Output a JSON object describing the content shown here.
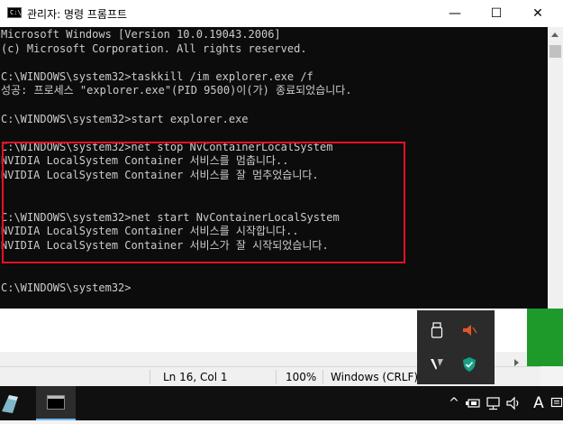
{
  "window": {
    "title": "관리자: 명령 프롬프트",
    "icon": "cmd-icon",
    "icon_glyph": "C:\\",
    "minimize_glyph": "—",
    "maximize_glyph": "☐",
    "close_glyph": "✕"
  },
  "console": {
    "lines": [
      "Microsoft Windows [Version 10.0.19043.2006]",
      "(c) Microsoft Corporation. All rights reserved.",
      "",
      "C:\\WINDOWS\\system32>taskkill /im explorer.exe /f",
      "성공: 프로세스 \"explorer.exe\"(PID 9500)이(가) 종료되었습니다.",
      "",
      "C:\\WINDOWS\\system32>start explorer.exe",
      "",
      "C:\\WINDOWS\\system32>net stop NvContainerLocalSystem",
      "NVIDIA LocalSystem Container 서비스를 멈춥니다..",
      "NVIDIA LocalSystem Container 서비스를 잘 멈추었습니다.",
      "",
      "",
      "C:\\WINDOWS\\system32>net start NvContainerLocalSystem",
      "NVIDIA LocalSystem Container 서비스를 시작합니다..",
      "NVIDIA LocalSystem Container 서비스가 잘 시작되었습니다.",
      "",
      "",
      "C:\\WINDOWS\\system32>"
    ],
    "highlight_color": "#e81123",
    "text_color": "#cccccc",
    "background": "#0c0c0c"
  },
  "statusbar": {
    "position": "Ln 16, Col 1",
    "zoom": "100%",
    "line_ending": "Windows (CRLF)"
  },
  "tray_flyout": {
    "icons": [
      "usb-drive-icon",
      "speaker-muted-icon",
      "vpn-icon",
      "security-shield-icon"
    ]
  },
  "taskbar": {
    "apps": [
      "app-icon",
      "command-prompt-icon"
    ],
    "system": {
      "chevron": "^",
      "ime": "A"
    }
  },
  "colors": {
    "accent_green": "#1e9a2a",
    "taskbar": "#101010",
    "active_indicator": "#76b9ed"
  }
}
